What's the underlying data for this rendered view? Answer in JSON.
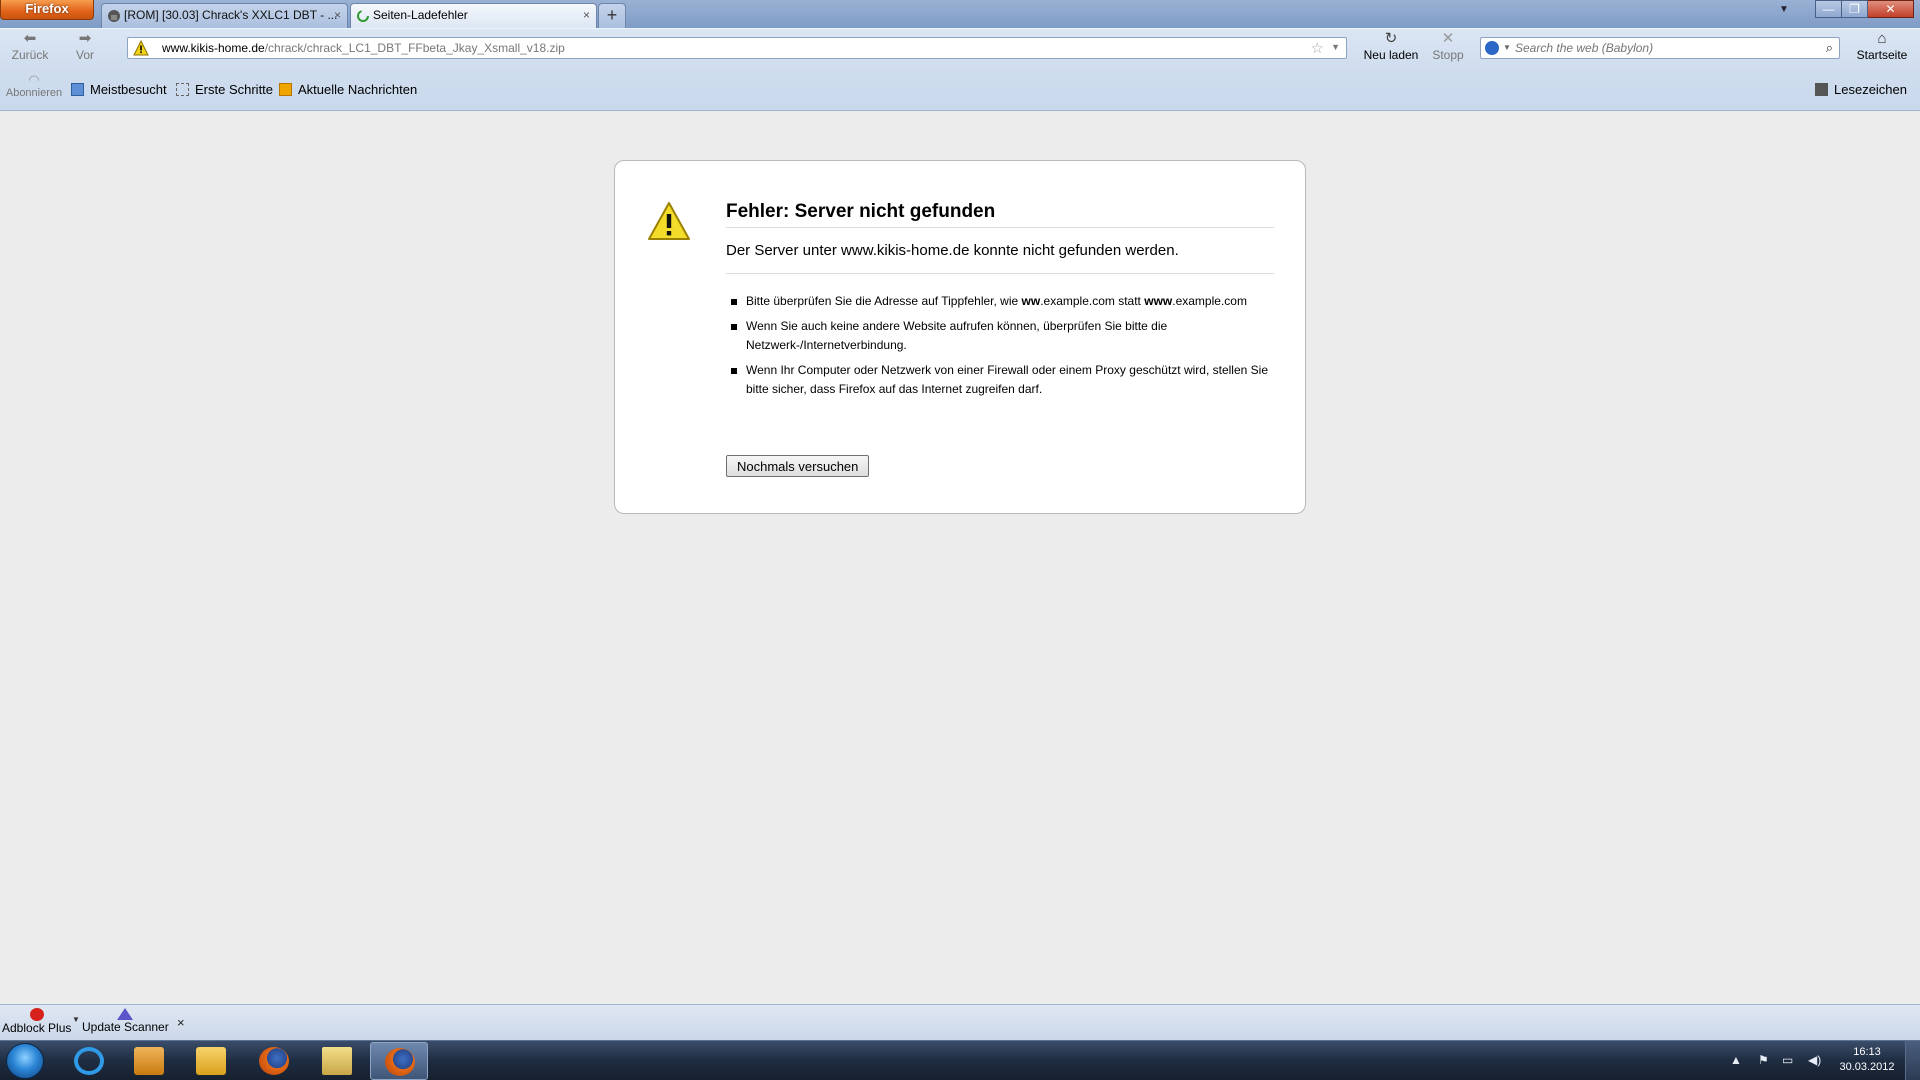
{
  "window": {
    "app_menu_label": "Firefox",
    "tabs": [
      {
        "label": "[ROM] [30.03] Chrack's XXLC1 DBT - ...",
        "active": false
      },
      {
        "label": "Seiten-Ladefehler",
        "active": true
      }
    ],
    "new_tab_label": "+"
  },
  "navbar": {
    "back_label": "Zurück",
    "forward_label": "Vor",
    "url_host": "www.kikis-home.de",
    "url_path": "/chrack/chrack_LC1_DBT_FFbeta_Jkay_Xsmall_v18.zip",
    "reload_label": "Neu laden",
    "stop_label": "Stopp",
    "search_placeholder": "Search the web (Babylon)",
    "home_label": "Startseite"
  },
  "bookmarks": {
    "subscribe_label": "Abonnieren",
    "items": [
      {
        "label": "Meistbesucht"
      },
      {
        "label": "Erste Schritte"
      },
      {
        "label": "Aktuelle Nachrichten"
      }
    ],
    "bookmarks_menu_label": "Lesezeichen"
  },
  "error": {
    "title": "Fehler: Server nicht gefunden",
    "description": "Der Server unter www.kikis-home.de konnte nicht gefunden werden.",
    "tips": [
      {
        "pre": "Bitte überprüfen Sie die Adresse auf Tippfehler, wie ",
        "bold1": "ww",
        "mid": ".example.com statt ",
        "bold2": "www",
        "post": ".example.com"
      },
      {
        "text": "Wenn Sie auch keine andere Website aufrufen können, überprüfen Sie bitte die Netzwerk-/Internetverbindung."
      },
      {
        "text": "Wenn Ihr Computer oder Netzwerk von einer Firewall oder einem Proxy geschützt wird, stellen Sie bitte sicher, dass Firefox auf das Internet zugreifen darf."
      }
    ],
    "retry_label": "Nochmals versuchen"
  },
  "addonbar": {
    "items": [
      {
        "label": "Adblock Plus",
        "icon": "abp-icon"
      },
      {
        "label": "Update Scanner",
        "icon": "update-scanner-icon"
      }
    ],
    "close_label": "×"
  },
  "taskbar": {
    "items": [
      "internet-explorer-icon",
      "media-player-icon",
      "mail-icon",
      "firefox-icon",
      "explorer-folder-icon",
      "firefox-active-icon"
    ],
    "clock_time": "16:13",
    "clock_date": "30.03.2012"
  },
  "colors": {
    "firefox_button": "#e1631a",
    "chrome_blue": "#cfddee",
    "page_bg": "#ececec"
  }
}
